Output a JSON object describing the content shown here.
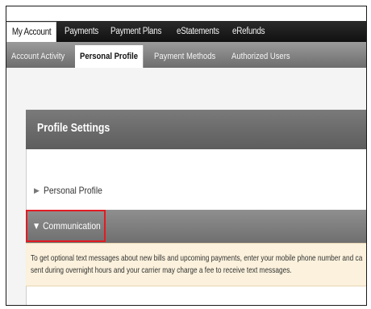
{
  "tabs_primary": [
    {
      "label": "My Account",
      "active": true
    },
    {
      "label": "Payments",
      "active": false
    },
    {
      "label": "Payment Plans",
      "active": false
    },
    {
      "label": "eStatements",
      "active": false
    },
    {
      "label": "eRefunds",
      "active": false
    }
  ],
  "tabs_secondary": [
    {
      "label": "Account Activity",
      "active": false
    },
    {
      "label": "Personal Profile",
      "active": true
    },
    {
      "label": "Payment Methods",
      "active": false
    },
    {
      "label": "Authorized Users",
      "active": false
    }
  ],
  "profile_settings": {
    "title": "Profile Settings",
    "sections": {
      "personal_profile": {
        "label": "Personal Profile",
        "expanded": false
      },
      "communication": {
        "label": "Communication",
        "expanded": true
      }
    },
    "communication_text": {
      "line1": "To get optional text messages about new bills and upcoming payments, enter your mobile phone number and ca",
      "line2": "sent during overnight hours and your carrier may charge a fee to receive text messages."
    }
  },
  "colors": {
    "highlight_border": "#e31b23",
    "notice_background": "#fbf1dc"
  },
  "icons": {
    "collapsed": "triangle-right",
    "expanded": "triangle-down"
  }
}
